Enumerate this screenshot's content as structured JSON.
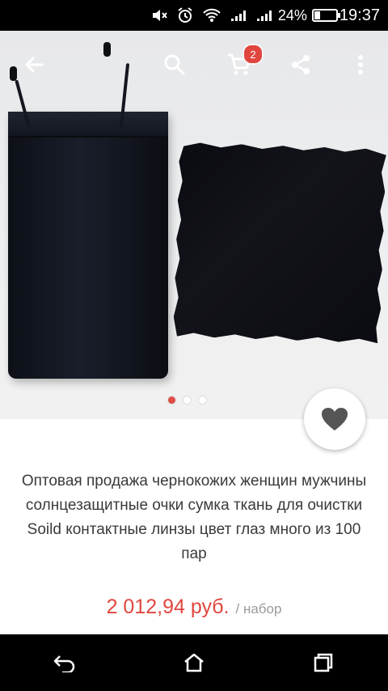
{
  "status_bar": {
    "battery_percent": "24%",
    "time": "19:37",
    "icons": [
      "mute-icon",
      "alarm-icon",
      "wifi-icon",
      "signal-1-icon",
      "signal-2-icon",
      "battery-icon"
    ]
  },
  "app_bar": {
    "icons": [
      "back-arrow-icon",
      "search-icon",
      "cart-icon",
      "share-icon",
      "more-vert-icon"
    ],
    "cart_count": "2"
  },
  "gallery": {
    "page_count": 3,
    "active_index": 0
  },
  "product": {
    "title": "Оптовая продажа чернокожих женщин мужчины солнцезащитные очки сумка ткань для очистки Soild контактные линзы цвет глаз много из 100 пар",
    "price": "2 012,94 руб.",
    "unit": "/ набор"
  },
  "nav_bar": {
    "icons": [
      "back-nav-icon",
      "home-icon",
      "recent-apps-icon"
    ]
  },
  "colors": {
    "accent": "#e0463f",
    "title_text": "#3a3a3a",
    "unit_text": "#9a9a9a"
  }
}
